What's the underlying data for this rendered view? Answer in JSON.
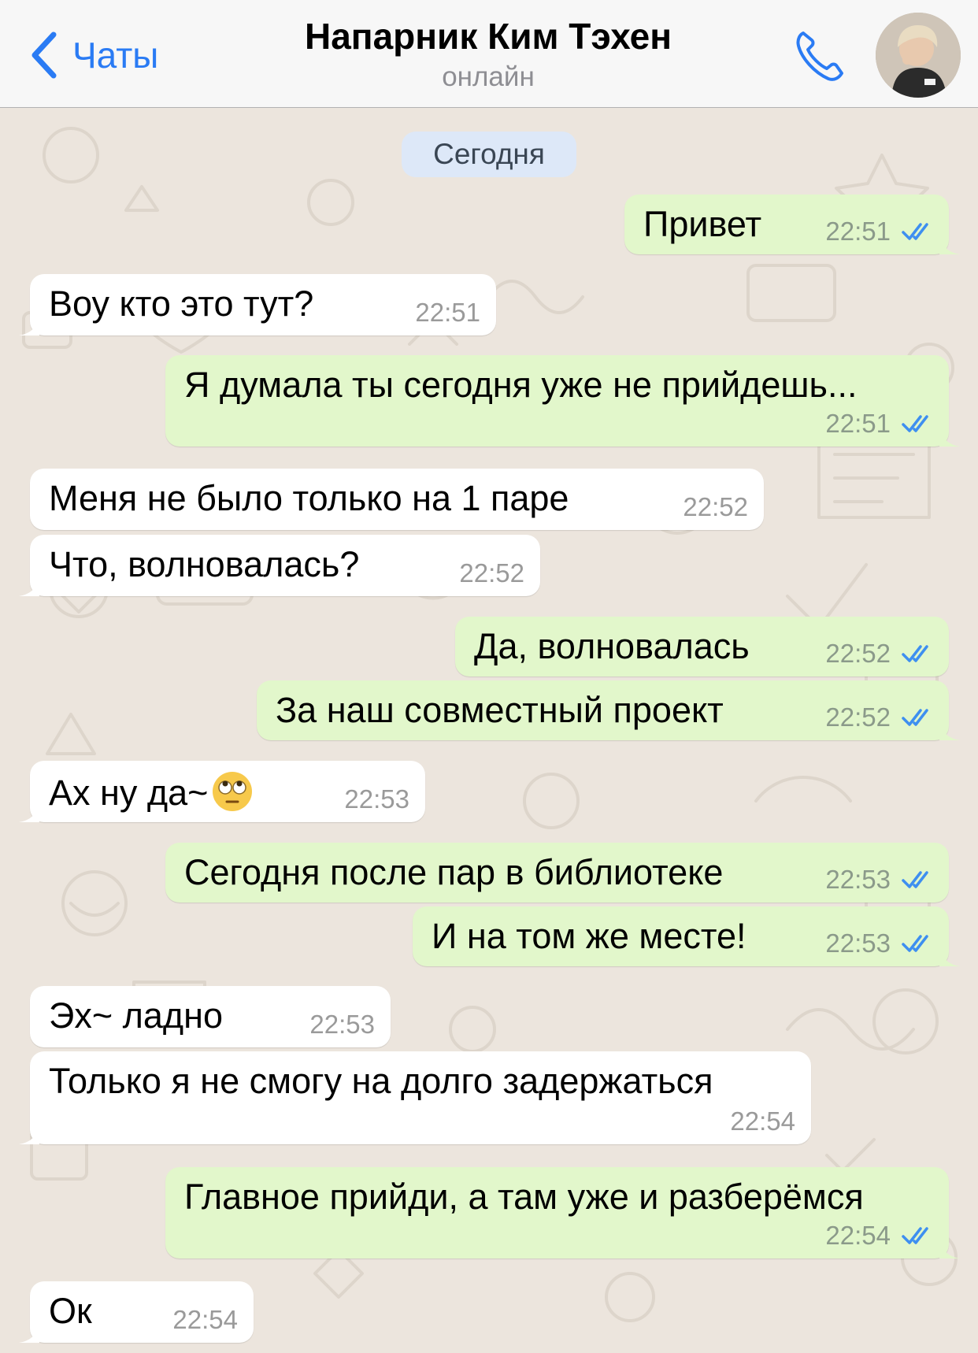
{
  "header": {
    "back_label": "Чаты",
    "title": "Напарник Ким Тэхен",
    "subtitle": "онлайн"
  },
  "colors": {
    "accent": "#2a7bf4",
    "incoming_bubble": "#ffffff",
    "outgoing_bubble": "#e2f7cb",
    "read_ticks": "#3e8ff0",
    "chat_background": "#ece5dd"
  },
  "chat": {
    "date_label": "Сегодня",
    "messages": [
      {
        "dir": "out",
        "text": "Привет",
        "time": "22:51",
        "status": "read"
      },
      {
        "dir": "in",
        "text": "Воу кто это тут?",
        "time": "22:51"
      },
      {
        "dir": "out",
        "text": "Я думала ты сегодня уже не прийдешь...",
        "time": "22:51",
        "status": "read"
      },
      {
        "dir": "in",
        "text": "Меня не было только на 1 паре",
        "time": "22:52"
      },
      {
        "dir": "in",
        "text": "Что, волновалась?",
        "time": "22:52"
      },
      {
        "dir": "out",
        "text": "Да, волновалась",
        "time": "22:52",
        "status": "read"
      },
      {
        "dir": "out",
        "text": "За наш совместный проект",
        "time": "22:52",
        "status": "read"
      },
      {
        "dir": "in",
        "text": "Ах ну да~",
        "emoji": "face-with-rolling-eyes",
        "time": "22:53"
      },
      {
        "dir": "out",
        "text": "Сегодня после пар в библиотеке",
        "time": "22:53",
        "status": "read"
      },
      {
        "dir": "out",
        "text": "И на том же месте!",
        "time": "22:53",
        "status": "read"
      },
      {
        "dir": "in",
        "text": "Эх~ ладно",
        "time": "22:53"
      },
      {
        "dir": "in",
        "text": "Только я не смогу на долго задержаться",
        "time": "22:54"
      },
      {
        "dir": "out",
        "text": "Главное прийди, а там уже и разберёмся",
        "time": "22:54",
        "status": "read"
      },
      {
        "dir": "in",
        "text": "Ок",
        "time": "22:54"
      }
    ]
  },
  "icons": {
    "back": "chevron-left-icon",
    "call": "phone-icon",
    "read": "double-check-icon"
  }
}
